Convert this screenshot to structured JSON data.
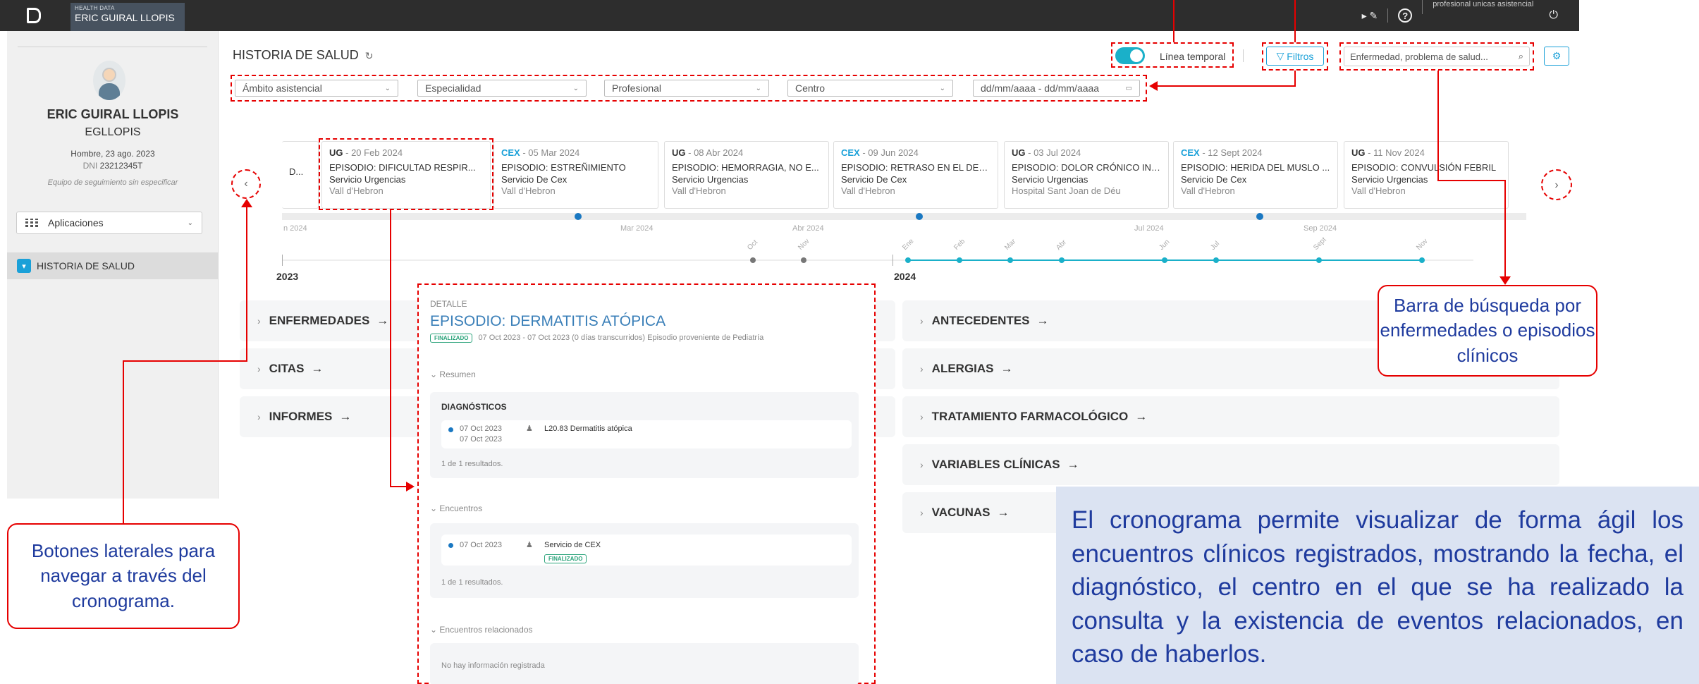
{
  "topbar": {
    "brand_small": "HEALTH DATA",
    "brand_name": "ERIC GUIRAL LLOPIS",
    "play_icon": "▸",
    "pin_icon": "✎",
    "help_icon": "?",
    "profile": "profesional unicas asistencial",
    "power_icon": "⏻"
  },
  "sidebar": {
    "name": "ERIC GUIRAL LLOPIS",
    "username": "EGLLOPIS",
    "info": "Hombre, 23 ago. 2023",
    "dni_label": "DNI",
    "dni_value": "23212345T",
    "team": "Equipo de seguimiento sin especificar",
    "apps_label": "Aplicaciones",
    "nav_item": "HISTORIA DE SALUD"
  },
  "header": {
    "title": "HISTORIA DE SALUD",
    "reload_icon": "↻",
    "timeline_label": "Línea temporal",
    "filters_label": "Filtros",
    "filter_icon": "▽",
    "search_placeholder": "Enfermedad, problema de salud...",
    "search_icon": "⌕",
    "settings_icon": "⚙"
  },
  "filters": [
    "Ámbito asistencial",
    "Especialidad",
    "Profesional",
    "Centro"
  ],
  "date_range": {
    "placeholder": "dd/mm/aaaa - dd/mm/aaaa",
    "icon": "▭"
  },
  "timeline": {
    "prev_icon": "‹",
    "next_icon": "›",
    "partial_card": "D...",
    "cards": [
      {
        "code": "UG",
        "date": "20 Feb 2024",
        "episode": "EPISODIO: DIFICULTAD RESPIR...",
        "service": "Servicio Urgencias",
        "center": "Vall d'Hebron"
      },
      {
        "code": "CEX",
        "date": "05 Mar 2024",
        "episode": "EPISODIO: ESTREÑIMIENTO",
        "service": "Servicio De Cex",
        "center": "Vall d'Hebron"
      },
      {
        "code": "UG",
        "date": "08 Abr 2024",
        "episode": "EPISODIO: HEMORRAGIA, NO E...",
        "service": "Servicio Urgencias",
        "center": "Vall d'Hebron"
      },
      {
        "code": "CEX",
        "date": "09 Jun 2024",
        "episode": "EPISODIO: RETRASO EN EL DES...",
        "service": "Servicio De Cex",
        "center": "Vall d'Hebron"
      },
      {
        "code": "UG",
        "date": "03 Jul 2024",
        "episode": "EPISODIO: DOLOR CRÓNICO INT...",
        "service": "Servicio Urgencias",
        "center": "Hospital Sant Joan de Déu"
      },
      {
        "code": "CEX",
        "date": "12 Sept 2024",
        "episode": "EPISODIO: HERIDA DEL MUSLO ...",
        "service": "Servicio De Cex",
        "center": "Vall d'Hebron"
      },
      {
        "code": "UG",
        "date": "11 Nov 2024",
        "episode": "EPISODIO: CONVULSIÓN FEBRIL",
        "service": "Servicio Urgencias",
        "center": "Vall d'Hebron"
      }
    ],
    "track_ticks": [
      "n 2024",
      "Mar 2024",
      "Abr 2024",
      "Jul 2024",
      "Sep 2024"
    ],
    "months": [
      "Oct",
      "Nov",
      "Ene",
      "Feb",
      "Mar",
      "Abr",
      "Jun",
      "Jul",
      "Sept",
      "Nov"
    ],
    "years": [
      "2023",
      "2024"
    ]
  },
  "accordions_left": [
    "ENFERMEDADES",
    "CITAS",
    "INFORMES"
  ],
  "accordions_right": [
    "ANTECEDENTES",
    "ALERGIAS",
    "TRATAMIENTO FARMACOLÓGICO",
    "VARIABLES CLÍNICAS",
    "VACUNAS"
  ],
  "accordion_caret": "›",
  "accordion_arrow": "→",
  "detail": {
    "label": "DETALLE",
    "title": "EPISODIO: DERMATITIS ATÓPICA",
    "badge": "FINALIZADO",
    "meta": "07 Oct 2023 - 07 Oct 2023 (0 días transcurridos) Episodio proveniente de Pediatría",
    "section_caret": "⌄",
    "person_icon": "♟",
    "resumen": "Resumen",
    "diag_title": "DIAGNÓSTICOS",
    "diag_date1": "07 Oct 2023",
    "diag_date2": "07 Oct 2023",
    "diag_text": "L20.83 Dermatitis atópica",
    "diag_results": "1 de 1 resultados.",
    "encuentros": "Encuentros",
    "enc_date": "07 Oct 2023",
    "enc_text": "Servicio de CEX",
    "enc_badge": "FINALIZADO",
    "enc_results": "1 de 1 resultados.",
    "relacionados": "Encuentros relacionados",
    "no_info": "No hay información registrada"
  },
  "annotations": {
    "lateral": "Botones laterales para navegar a través del cronograma.",
    "search": "Barra de búsqueda por enfermedades o episodios clínicos",
    "info": "El cronograma permite visualizar de forma ágil los encuentros clínicos registrados, mostrando la fecha, el diagnóstico, el centro en el que se ha realizado la consulta y la existencia de eventos relacionados, en caso de haberlos."
  },
  "colors": {
    "accent": "#1aa0d8",
    "annotation_red": "#e60000",
    "annotation_text": "#1f3b9e",
    "info_bg": "#dbe3f2",
    "timeline_teal": "#1ab0c9"
  }
}
